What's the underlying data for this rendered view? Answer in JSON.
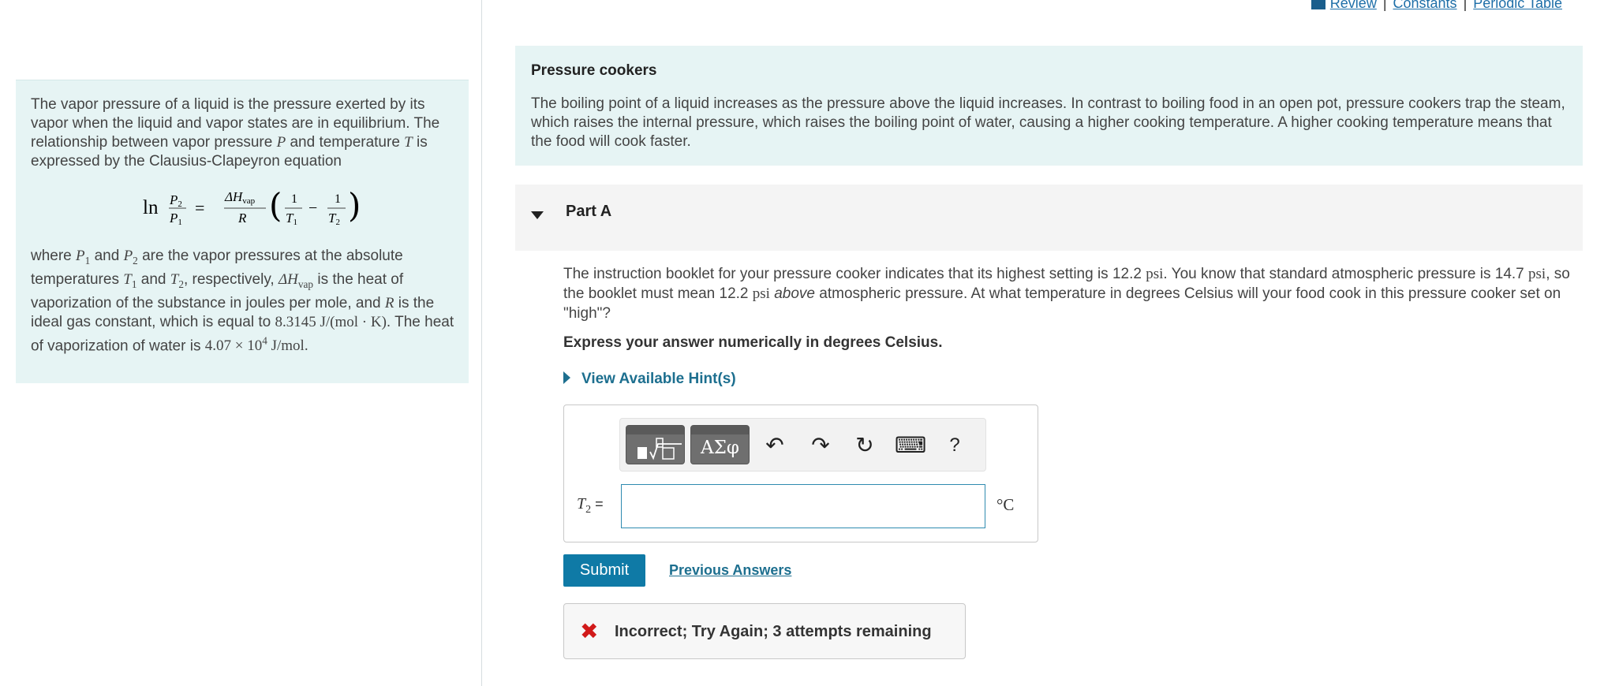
{
  "top_links": {
    "review": "Review",
    "constants": "Constants",
    "periodic_table": "Periodic Table",
    "separator": "|"
  },
  "left_panel": {
    "p1": "The vapor pressure of a liquid is the pressure exerted by its vapor when the liquid and vapor states are in equilibrium. The relationship between vapor pressure",
    "p1_and": "and temperature",
    "p1_end": "is expressed by the Clausius-Clapeyron equation",
    "var_P": "P",
    "var_T": "T",
    "eq_ln": "ln",
    "eq_P2": "P",
    "eq_P1": "P",
    "eq_dH": "ΔH",
    "eq_vap": "vap",
    "eq_R": "R",
    "eq_one": "1",
    "eq_T1": "T",
    "eq_T2": "T",
    "sub1": "1",
    "sub2": "2",
    "p2_where": "where",
    "p2_and": "and",
    "p2_a": "are the vapor pressures at the absolute temperatures",
    "p2_b": "and",
    "p2_c": ", respectively,",
    "p2_d": "is the heat of vaporization of the substance in joules per mole, and",
    "p2_e": "is the ideal gas constant, which is equal to",
    "gas_const": "8.3145 J/(mol · K)",
    "p2_f": ". The heat of vaporization of water is",
    "heat_val": "4.07 × 10",
    "heat_exp": "4",
    "heat_unit": " J/mol."
  },
  "intro": {
    "title": "Pressure cookers",
    "body": "The boiling point of a liquid increases as the pressure above the liquid increases. In contrast to boiling food in an open pot, pressure cookers trap the steam, which raises the internal pressure, which raises the boiling point of water, causing a higher cooking temperature.  A higher cooking temperature means that the food will cook faster."
  },
  "part": {
    "label": "Part A"
  },
  "question": {
    "a": "The instruction booklet for your pressure cooker indicates that its highest setting is 12.2",
    "unit": "psi",
    "b": ". You know that standard atmospheric pressure is 14.7",
    "c": ", so the booklet must mean 12.2",
    "above": "above",
    "d": "atmospheric pressure. At what temperature in degrees Celsius will your food cook in this pressure cooker set on \"high\"?"
  },
  "instruction": "Express your answer numerically in degrees Celsius.",
  "hint_link": "View Available Hint(s)",
  "toolbar": {
    "greek": "ΑΣφ",
    "undo": "↶",
    "redo": "↷",
    "reset": "↻",
    "keyboard": "⌨",
    "help": "?"
  },
  "answer": {
    "var": "T",
    "sub": "2",
    "eq": " =",
    "value": "",
    "unit": "°C"
  },
  "submit_label": "Submit",
  "previous_answers": "Previous Answers",
  "feedback": {
    "icon": "✖",
    "text": "Incorrect; Try Again; 3 attempts remaining"
  }
}
